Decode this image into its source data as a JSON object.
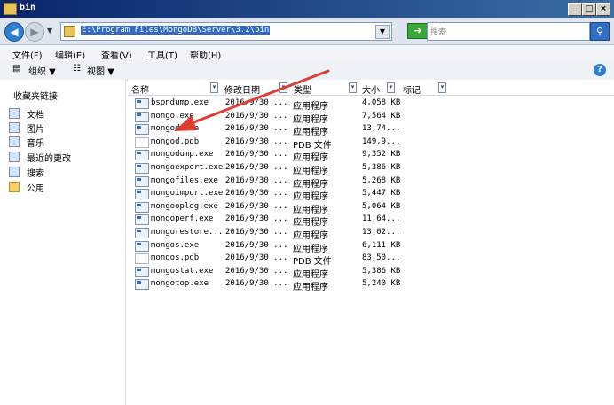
{
  "window": {
    "title": "bin"
  },
  "address": {
    "path": "E:\\Program Files\\MongoDB\\Server\\3.2\\bin"
  },
  "search": {
    "placeholder": "搜索"
  },
  "menu": [
    "文件(F)",
    "编辑(E)",
    "查看(V)",
    "工具(T)",
    "帮助(H)"
  ],
  "commands": {
    "organize": "组织 ▼",
    "views": "视图 ▼"
  },
  "sidebar": {
    "header": "收藏夹链接",
    "items": [
      "文档",
      "图片",
      "音乐",
      "最近的更改",
      "搜索",
      "公用"
    ]
  },
  "columns": [
    "名称",
    "修改日期",
    "类型",
    "大小",
    "标记"
  ],
  "files": [
    {
      "name": "bsondump.exe",
      "date": "2016/9/30 ...",
      "type": "应用程序",
      "size": "4,058 KB",
      "icon": "exe"
    },
    {
      "name": "mongo.exe",
      "date": "2016/9/30 ...",
      "type": "应用程序",
      "size": "7,564 KB",
      "icon": "exe"
    },
    {
      "name": "mongod.exe",
      "date": "2016/9/30 ...",
      "type": "应用程序",
      "size": "13,74...",
      "icon": "exe"
    },
    {
      "name": "mongod.pdb",
      "date": "2016/9/30 ...",
      "type": "PDB 文件",
      "size": "149,9...",
      "icon": "pdb"
    },
    {
      "name": "mongodump.exe",
      "date": "2016/9/30 ...",
      "type": "应用程序",
      "size": "9,352 KB",
      "icon": "exe"
    },
    {
      "name": "mongoexport.exe",
      "date": "2016/9/30 ...",
      "type": "应用程序",
      "size": "5,386 KB",
      "icon": "exe"
    },
    {
      "name": "mongofiles.exe",
      "date": "2016/9/30 ...",
      "type": "应用程序",
      "size": "5,268 KB",
      "icon": "exe"
    },
    {
      "name": "mongoimport.exe",
      "date": "2016/9/30 ...",
      "type": "应用程序",
      "size": "5,447 KB",
      "icon": "exe"
    },
    {
      "name": "mongooplog.exe",
      "date": "2016/9/30 ...",
      "type": "应用程序",
      "size": "5,064 KB",
      "icon": "exe"
    },
    {
      "name": "mongoperf.exe",
      "date": "2016/9/30 ...",
      "type": "应用程序",
      "size": "11,64...",
      "icon": "exe"
    },
    {
      "name": "mongorestore...",
      "date": "2016/9/30 ...",
      "type": "应用程序",
      "size": "13,02...",
      "icon": "exe"
    },
    {
      "name": "mongos.exe",
      "date": "2016/9/30 ...",
      "type": "应用程序",
      "size": "6,111 KB",
      "icon": "exe"
    },
    {
      "name": "mongos.pdb",
      "date": "2016/9/30 ...",
      "type": "PDB 文件",
      "size": "83,50...",
      "icon": "pdb"
    },
    {
      "name": "mongostat.exe",
      "date": "2016/9/30 ...",
      "type": "应用程序",
      "size": "5,386 KB",
      "icon": "exe"
    },
    {
      "name": "mongotop.exe",
      "date": "2016/9/30 ...",
      "type": "应用程序",
      "size": "5,240 KB",
      "icon": "exe"
    }
  ],
  "colors": {
    "titlebar": "#0a246a",
    "selection": "#316ac5",
    "annotation_arrow": "#e03c31"
  }
}
